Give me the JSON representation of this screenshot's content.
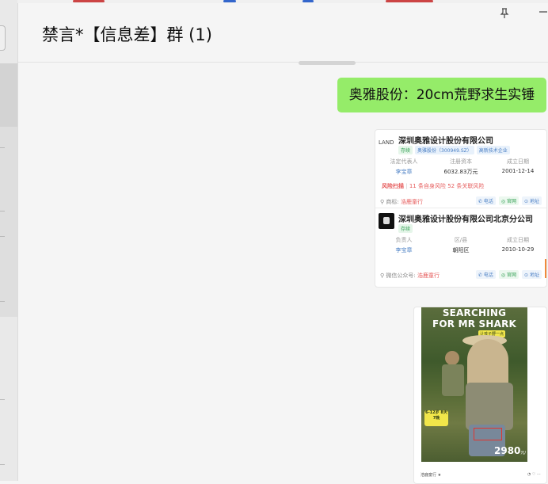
{
  "window": {
    "title": "禁言*【信息差】群 (1)",
    "pin_icon": "pin-icon",
    "minimize_icon": "minimize-icon"
  },
  "messages": [
    {
      "type": "text",
      "sender": "self",
      "text": "奥雅股份：20cm荒野求生实锤",
      "bubble_color": "#95ec69"
    },
    {
      "type": "image-card",
      "entries": [
        {
          "company": "深圳奥雅设计股份有限公司",
          "tags": [
            "存续",
            "奥雅股份（300949.SZ）",
            "高新技术企业"
          ],
          "fields": [
            {
              "label": "法定代表人",
              "value": "李宝章"
            },
            {
              "label": "注册资本",
              "value": "6032.83万元"
            },
            {
              "label": "成立日期",
              "value": "2001-12-14"
            }
          ],
          "risk": {
            "label": "风险扫描",
            "self": "11 条自身风险",
            "related": "52 条关联风险"
          },
          "footer": {
            "label": "商标:",
            "value": "浩鹿童行"
          },
          "actions": [
            "电话",
            "官网",
            "地址"
          ]
        },
        {
          "company": "深圳奥雅设计股份有限公司北京分公司",
          "tags": [
            "存续"
          ],
          "fields": [
            {
              "label": "负责人",
              "value": "李宝章"
            },
            {
              "label": "区/县",
              "value": "朝阳区"
            },
            {
              "label": "成立日期",
              "value": "2010-10-29"
            }
          ],
          "footer": {
            "label": "微信公众号:",
            "value": "浩鹿童行"
          },
          "actions": [
            "电话",
            "官网",
            "地址"
          ]
        }
      ]
    },
    {
      "type": "image-poster",
      "poster": {
        "headline_1": "SEARCHING",
        "headline_2": "FOR MR SHARK",
        "sub": "让孩子野一点",
        "badge": "6-12岁 8天7晚",
        "price": "2980",
        "price_unit": "元/人",
        "footer_left": "浩鹿童行 ★",
        "footer_icons": "◔ ♡ ⋯"
      }
    }
  ],
  "colors": {
    "background": "#f5f5f5",
    "bubble": "#95ec69",
    "link_blue": "#4a7fc4",
    "risk_red": "#e65c5c",
    "tag_green": "#2f9e50"
  }
}
